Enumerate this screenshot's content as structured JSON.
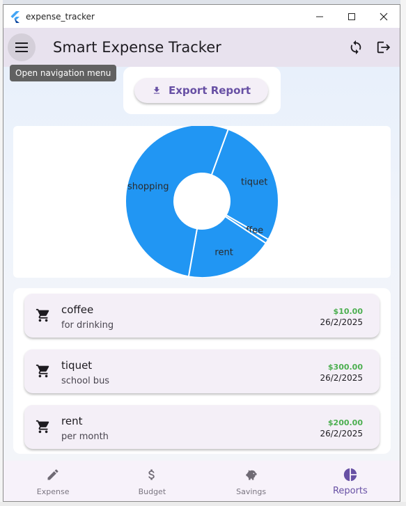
{
  "window": {
    "title": "expense_tracker"
  },
  "appbar": {
    "title": "Smart Expense Tracker"
  },
  "tooltip": {
    "text": "Open navigation menu"
  },
  "export": {
    "label": "Export Report"
  },
  "colors": {
    "pie": "#2196f3",
    "accent": "#6750a4",
    "amount": "#4caf50"
  },
  "chart_data": {
    "type": "pie",
    "donut": true,
    "slices": [
      {
        "label": "tiquet",
        "value": 300.0
      },
      {
        "label": "coffee",
        "value": 10.0
      },
      {
        "label": "rent",
        "value": 200.0
      },
      {
        "label": "shopping",
        "value": 570.0
      }
    ]
  },
  "transactions": [
    {
      "title": "coffee",
      "subtitle": "for drinking",
      "amount": "$10.00",
      "date": "26/2/2025",
      "icon": "cart-icon"
    },
    {
      "title": "tiquet",
      "subtitle": "school bus",
      "amount": "$300.00",
      "date": "26/2/2025",
      "icon": "cart-icon"
    },
    {
      "title": "rent",
      "subtitle": "per month",
      "amount": "$200.00",
      "date": "26/2/2025",
      "icon": "cart-icon"
    }
  ],
  "nav": [
    {
      "label": "Expense",
      "icon": "pencil-icon"
    },
    {
      "label": "Budget",
      "icon": "dollar-icon"
    },
    {
      "label": "Savings",
      "icon": "piggy-bank-icon"
    },
    {
      "label": "Reports",
      "icon": "pie-chart-icon",
      "active": true
    }
  ]
}
